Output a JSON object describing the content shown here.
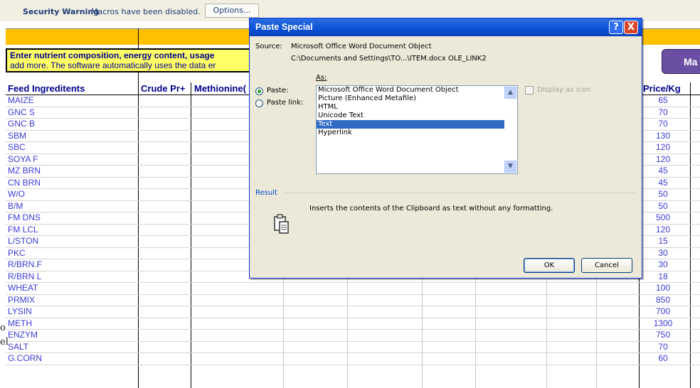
{
  "security_bar": {
    "title": "Security Warning",
    "message": "Macros have been disabled.",
    "options_button": "Options..."
  },
  "sheet": {
    "instruction_line1": "Enter nutrient composition, energy content, usage",
    "instruction_line2": "add more. The software automatically uses the data er",
    "macro_button": "Ma",
    "headers": {
      "feed": "Feed Ingreditents",
      "crude": "Crude Pr+",
      "methionine": "Methionine(",
      "price": "Price/Kg"
    },
    "left_stub1": "o",
    "left_stub2": "el",
    "rows": [
      {
        "name": "MAIZE",
        "price": "65"
      },
      {
        "name": "GNC  S",
        "price": "70"
      },
      {
        "name": "GNC B",
        "price": "70"
      },
      {
        "name": "SBM",
        "price": "130"
      },
      {
        "name": "SBC",
        "price": "120"
      },
      {
        "name": "SOYA F",
        "price": "120"
      },
      {
        "name": "MZ BRN",
        "price": "45"
      },
      {
        "name": "CN BRN",
        "price": "45"
      },
      {
        "name": "W/O",
        "price": "50"
      },
      {
        "name": "B/M",
        "price": "50"
      },
      {
        "name": "FM DNS",
        "price": "500"
      },
      {
        "name": "FM LCL",
        "price": "120"
      },
      {
        "name": "L/STON",
        "price": "15"
      },
      {
        "name": "PKC",
        "price": "30"
      },
      {
        "name": "R/BRN.F",
        "price": "30"
      },
      {
        "name": "R/BRN L",
        "price": "18"
      },
      {
        "name": "WHEAT",
        "price": "100"
      },
      {
        "name": "PRMIX",
        "price": "850"
      },
      {
        "name": "LYSIN",
        "price": "700"
      },
      {
        "name": "METH",
        "price": "1300"
      },
      {
        "name": "ENZYM",
        "price": "750"
      },
      {
        "name": "SALT",
        "price": "70"
      },
      {
        "name": "G.CORN",
        "price": "60"
      }
    ]
  },
  "dialog": {
    "title": "Paste Special",
    "help_button": "?",
    "close_button": "X",
    "source_label": "Source:",
    "source_line1": "Microsoft Office Word Document Object",
    "source_line2": "C:\\Documents and Settings\\TO...\\ITEM.docx OLE_LINK2",
    "as_label": "As:",
    "paste_label": "Paste:",
    "paste_link_label": "Paste link:",
    "paste_selected": true,
    "formats": [
      "Microsoft Office Word Document Object",
      "Picture (Enhanced Metafile)",
      "HTML",
      "Unicode Text",
      "Text",
      "Hyperlink"
    ],
    "selected_format": "Text",
    "display_as_icon": "Display as icon",
    "result_label": "Result",
    "result_text": "Inserts the contents of the Clipboard as text without any formatting.",
    "ok_button": "OK",
    "cancel_button": "Cancel"
  },
  "colors": {
    "band": "#ffc000",
    "instruction_bg": "#ffff66",
    "titlebar": "#0a4fd6",
    "selection": "#316ac5",
    "macro_button": "#6a4fa3"
  }
}
